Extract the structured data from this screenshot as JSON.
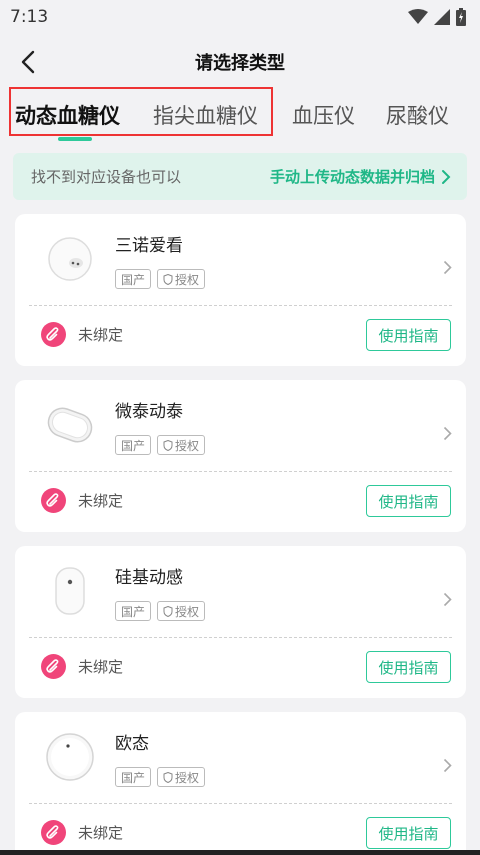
{
  "status_bar": {
    "time": "7:13"
  },
  "header": {
    "title": "请选择类型"
  },
  "tabs": [
    {
      "label": "动态血糖仪",
      "active": true
    },
    {
      "label": "指尖血糖仪",
      "active": false
    },
    {
      "label": "血压仪",
      "active": false
    },
    {
      "label": "尿酸仪",
      "active": false
    }
  ],
  "banner": {
    "text": "找不到对应设备也可以",
    "link": "手动上传动态数据并归档"
  },
  "devices": [
    {
      "name": "三诺爱看",
      "tag_origin": "国产",
      "tag_auth": "授权",
      "bind_status": "未绑定",
      "guide_label": "使用指南"
    },
    {
      "name": "微泰动泰",
      "tag_origin": "国产",
      "tag_auth": "授权",
      "bind_status": "未绑定",
      "guide_label": "使用指南"
    },
    {
      "name": "硅基动感",
      "tag_origin": "国产",
      "tag_auth": "授权",
      "bind_status": "未绑定",
      "guide_label": "使用指南"
    },
    {
      "name": "欧态",
      "tag_origin": "国产",
      "tag_auth": "授权",
      "bind_status": "未绑定",
      "guide_label": "使用指南"
    }
  ],
  "colors": {
    "accent": "#2ec99a",
    "bind_icon": "#f0457a",
    "highlight": "#e33333"
  }
}
